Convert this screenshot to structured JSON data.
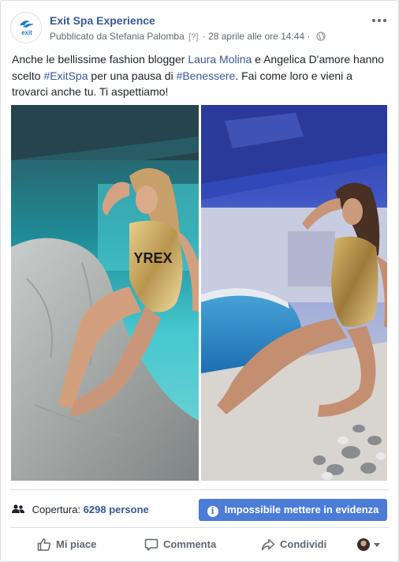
{
  "post": {
    "page_name": "Exit Spa Experience",
    "avatar_logo_text": "exit",
    "published_by_prefix": "Pubblicato da Stefania Palomba",
    "help_marker": "[?]",
    "separator": "·",
    "timestamp": "28 aprile alle ore 14:44",
    "separator2": "·",
    "audience_icon": "globe-icon",
    "more_icon": "more-options-icon"
  },
  "text": {
    "part1": "Anche le bellissime fashion blogger ",
    "mention": "Laura Molina",
    "part2": " e Angelica D'amore hanno scelto ",
    "hashtag1": "#ExitSpa",
    "part3": " per una pausa di ",
    "hashtag2": "#Benessere",
    "part4": ". Fai come loro e vieni a trovarci anche tu. Ti aspettiamo!"
  },
  "photos": {
    "left_swimsuit_text": "YREX"
  },
  "reach": {
    "icon": "people-icon",
    "label": "Copertura:",
    "count": "6298 persone"
  },
  "boost": {
    "icon": "info-icon",
    "label": "Impossibile mettere in evidenza"
  },
  "actions": {
    "like": "Mi piace",
    "comment": "Commenta",
    "share": "Condividi"
  },
  "colors": {
    "link": "#385898",
    "boost_button": "#4b7cd6",
    "muted": "#606770"
  }
}
